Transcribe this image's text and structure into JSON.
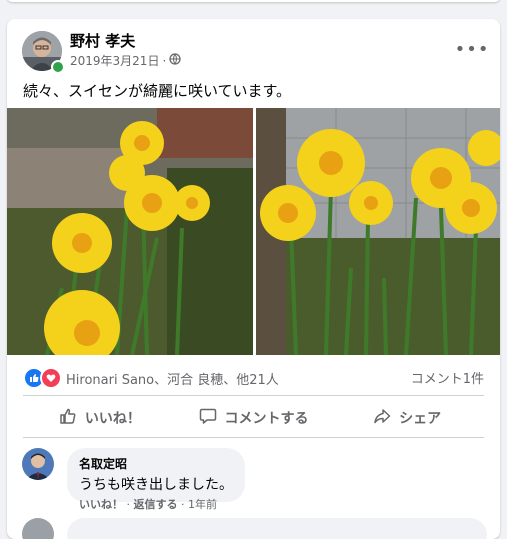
{
  "post": {
    "author": "野村 孝夫",
    "date": "2019年3月21日",
    "audience_icon": "globe-icon",
    "text": "続々、スイセンが綺麗に咲いています。",
    "photos": [
      {
        "subject": "yellow daffodils in garden"
      },
      {
        "subject": "yellow daffodils against wall"
      }
    ]
  },
  "reactions": {
    "icons": [
      "like-icon",
      "love-icon"
    ],
    "names": "Hironari Sano、河合 良穂、他21人",
    "comment_count": "コメント1件"
  },
  "actions": {
    "like": "いいね！",
    "comment": "コメントする",
    "share": "シェア"
  },
  "comments": [
    {
      "author": "名取定昭",
      "text": "うちも咲き出しました。",
      "like": "いいね！",
      "separator": "·",
      "reply": "返信する",
      "time": "1年前"
    }
  ],
  "colors": {
    "accent": "#1877f2",
    "love": "#f33e58",
    "muted_text": "#65676b",
    "online": "#31a24c"
  }
}
